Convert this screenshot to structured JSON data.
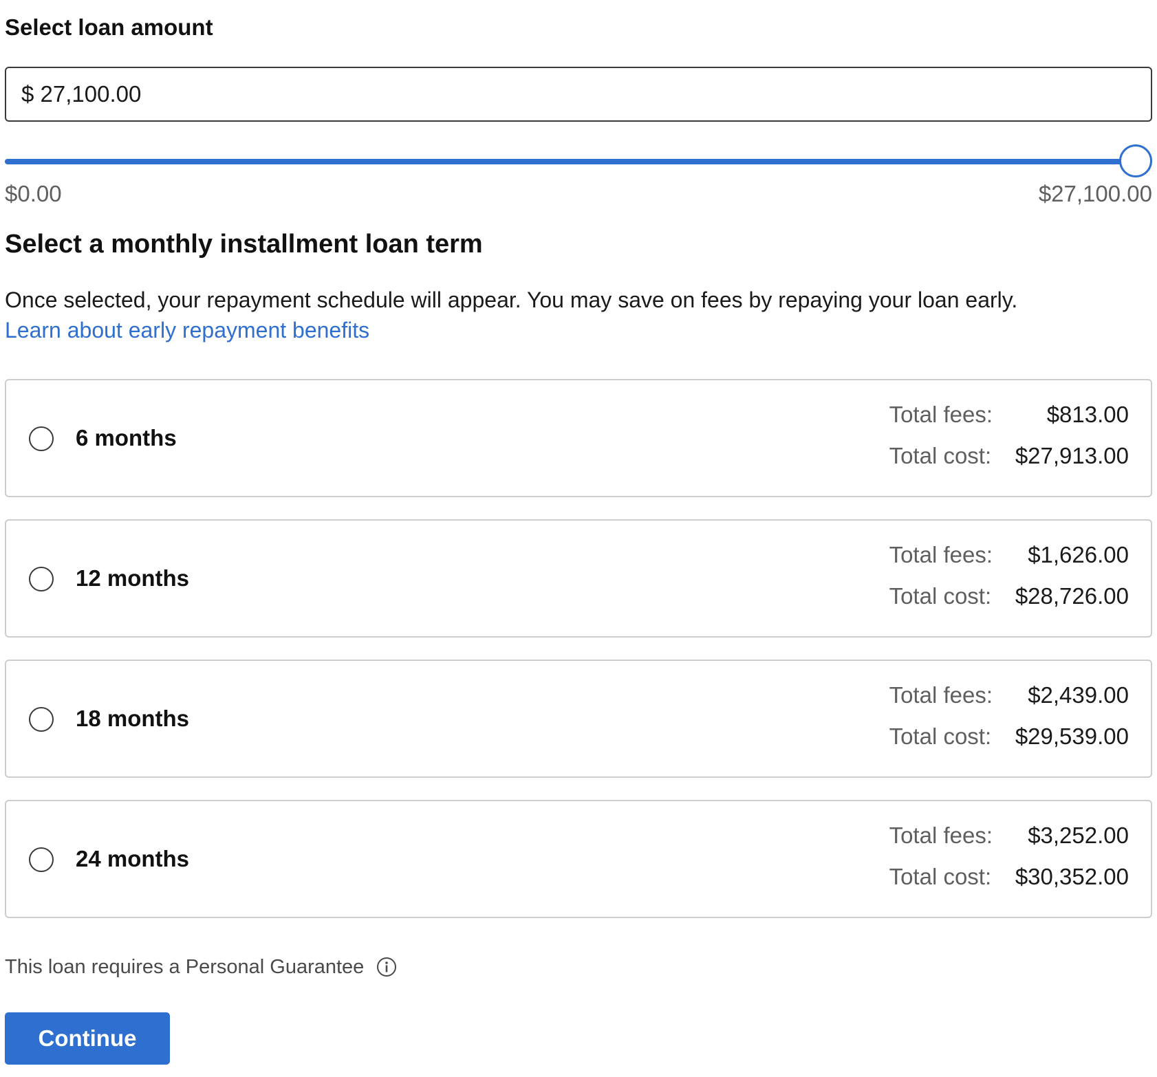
{
  "loan_amount": {
    "heading": "Select loan amount",
    "input_value": "$ 27,100.00",
    "slider": {
      "min_label": "$0.00",
      "max_label": "$27,100.00",
      "fraction": 1.0
    }
  },
  "loan_term": {
    "heading": "Select a monthly installment loan term",
    "description": "Once selected, your repayment schedule will appear. You may save on fees by repaying your loan early.",
    "link_text": "Learn about early repayment benefits",
    "fees_label": "Total fees:",
    "cost_label": "Total cost:",
    "options": [
      {
        "label": "6 months",
        "total_fees": "$813.00",
        "total_cost": "$27,913.00"
      },
      {
        "label": "12 months",
        "total_fees": "$1,626.00",
        "total_cost": "$28,726.00"
      },
      {
        "label": "18 months",
        "total_fees": "$2,439.00",
        "total_cost": "$29,539.00"
      },
      {
        "label": "24 months",
        "total_fees": "$3,252.00",
        "total_cost": "$30,352.00"
      }
    ]
  },
  "guarantee_text": "This loan requires a Personal Guarantee",
  "continue_label": "Continue",
  "colors": {
    "accent": "#2f6fcf",
    "text": "#1a1a1a",
    "muted": "#5f5f5f",
    "border": "#cdcdcd"
  }
}
